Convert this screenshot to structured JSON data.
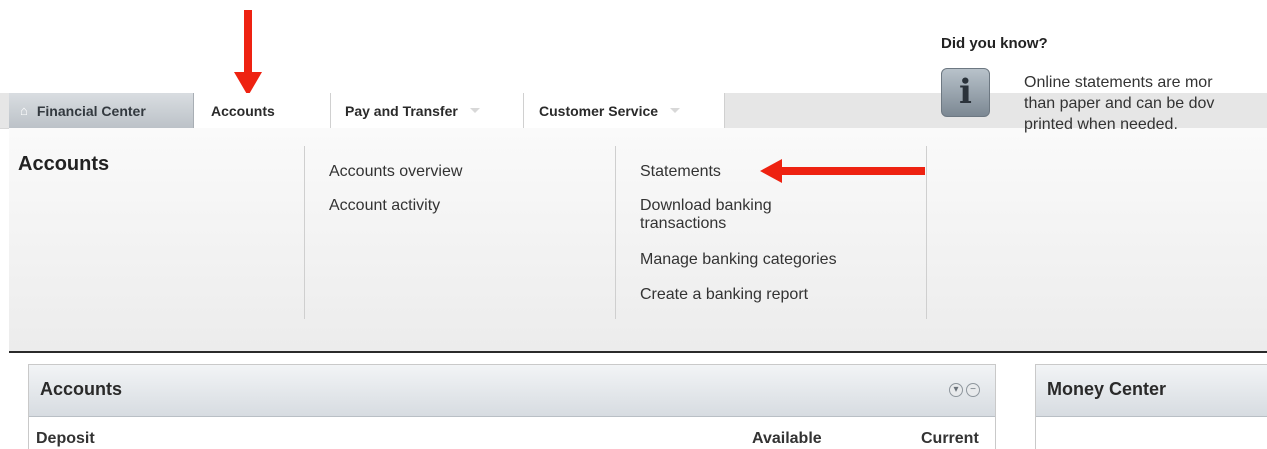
{
  "nav": {
    "tabs": [
      {
        "label": "Financial Center",
        "icon": "home-icon"
      },
      {
        "label": "Accounts"
      },
      {
        "label": "Pay and Transfer"
      },
      {
        "label": "Customer Service"
      }
    ]
  },
  "menu": {
    "title": "Accounts",
    "column1": [
      "Accounts overview",
      "Account activity"
    ],
    "column2": [
      "Statements",
      "Download banking",
      "transactions",
      "Manage banking categories",
      "Create a banking report"
    ],
    "did_you_know": {
      "title": "Did you know?",
      "lines": [
        "Online statements are mor",
        "than paper and can be dov",
        "printed when needed."
      ]
    }
  },
  "accounts_panel": {
    "title": "Accounts",
    "section": "Deposit",
    "columns": [
      "Available",
      "Current"
    ]
  },
  "money_center": {
    "title": "Money Center"
  },
  "annotation_color": "#ee2211"
}
